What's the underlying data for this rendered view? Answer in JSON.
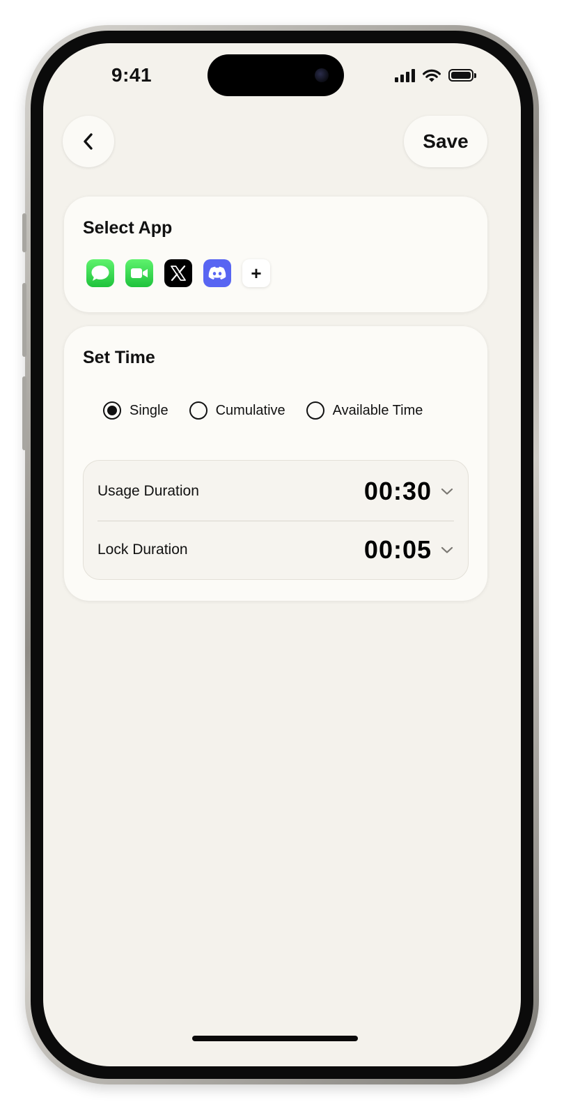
{
  "status_bar": {
    "time": "9:41"
  },
  "nav": {
    "back_icon": "chevron-left-icon",
    "save_label": "Save"
  },
  "select_app": {
    "title": "Select App",
    "apps": [
      {
        "name": "Messages",
        "icon": "messages-icon",
        "color": "#34c759"
      },
      {
        "name": "FaceTime",
        "icon": "facetime-icon",
        "color": "#30d158"
      },
      {
        "name": "X",
        "icon": "x-icon",
        "color": "#000000"
      },
      {
        "name": "Discord",
        "icon": "discord-icon",
        "color": "#5865f2"
      }
    ],
    "add_label": "+"
  },
  "set_time": {
    "title": "Set Time",
    "modes": [
      {
        "label": "Single",
        "selected": true
      },
      {
        "label": "Cumulative",
        "selected": false
      },
      {
        "label": "Available Time",
        "selected": false
      }
    ],
    "durations": [
      {
        "label": "Usage Duration",
        "value": "00:30"
      },
      {
        "label": "Lock Duration",
        "value": "00:05"
      }
    ]
  },
  "colors": {
    "background": "#f4f2ec",
    "card": "#fcfbf7",
    "text": "#111111"
  }
}
